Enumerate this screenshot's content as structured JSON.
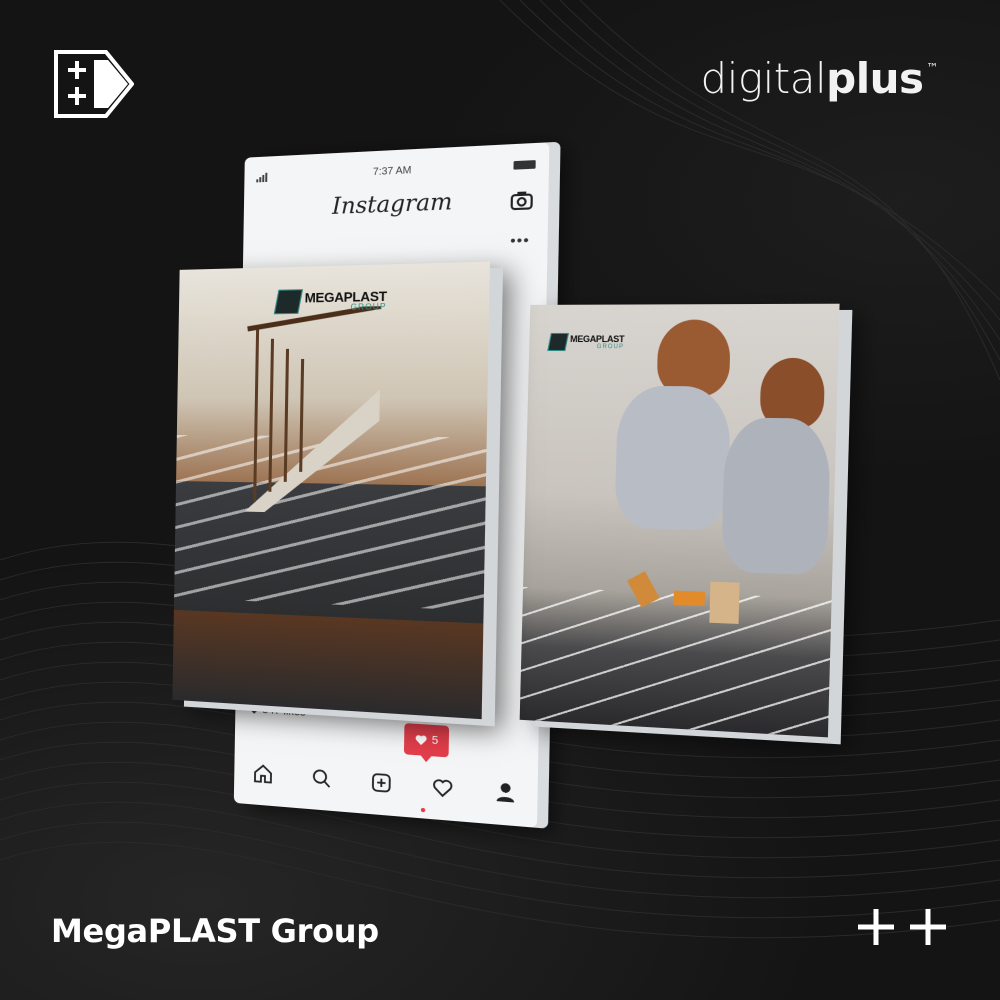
{
  "brand": {
    "wordmark_light": "digital",
    "wordmark_bold": "plus",
    "trademark": "™"
  },
  "phone": {
    "time": "7:37 AM",
    "app_title": "Instagram",
    "likes": "547 likes",
    "notification_count": "5",
    "tabs": [
      "home-icon",
      "search-icon",
      "add-post-icon",
      "heart-icon",
      "profile-icon"
    ]
  },
  "post1": {
    "logo_name": "MEGAPLAST",
    "logo_sub": "GROUP"
  },
  "post2": {
    "logo_name": "MEGAPLAST",
    "logo_sub": "GROUP"
  },
  "caption": "MegaPLAST Group",
  "colors": {
    "background": "#121212",
    "accent_red": "#e23d4a",
    "logo_teal": "#2f8f8a"
  }
}
